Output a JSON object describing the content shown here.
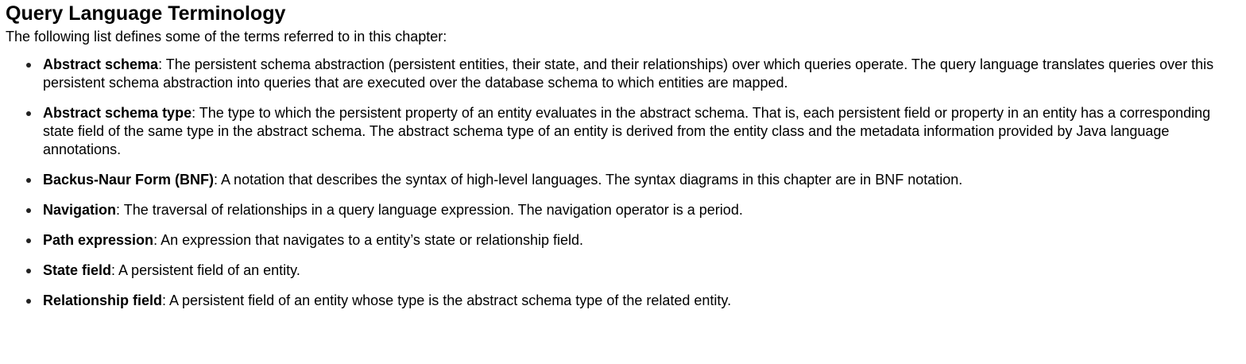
{
  "heading": "Query Language Terminology",
  "intro": "The following list defines some of the terms referred to in this chapter:",
  "terms": [
    {
      "name": "Abstract schema",
      "definition": ": The persistent schema abstraction (persistent entities, their state, and their relationships) over which queries operate. The query language translates queries over this persistent schema abstraction into queries that are executed over the database schema to which entities are mapped."
    },
    {
      "name": "Abstract schema type",
      "definition": ": The type to which the persistent property of an entity evaluates in the abstract schema. That is, each persistent field or property in an entity has a corresponding state field of the same type in the abstract schema. The abstract schema type of an entity is derived from the entity class and the metadata information provided by Java language annotations."
    },
    {
      "name": "Backus-Naur Form (BNF)",
      "definition": ": A notation that describes the syntax of high-level languages. The syntax diagrams in this chapter are in BNF notation."
    },
    {
      "name": "Navigation",
      "definition": ": The traversal of relationships in a query language expression. The navigation operator is a period."
    },
    {
      "name": "Path expression",
      "definition": ": An expression that navigates to a entity’s state or relationship field."
    },
    {
      "name": "State field",
      "definition": ": A persistent field of an entity."
    },
    {
      "name": "Relationship field",
      "definition": ": A persistent field of an entity whose type is the abstract schema type of the related entity."
    }
  ]
}
